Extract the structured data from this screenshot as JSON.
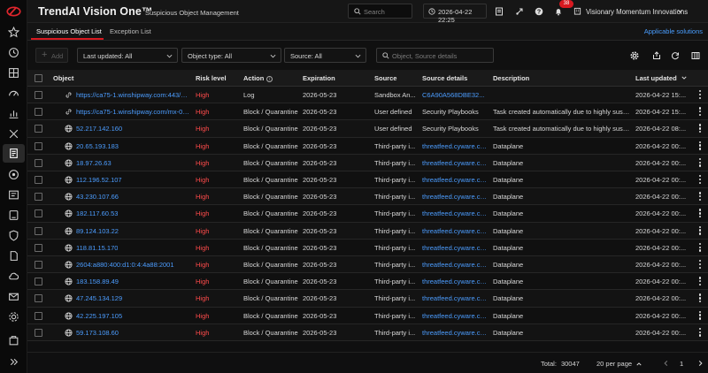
{
  "app": {
    "title": "TrendAI Vision One™",
    "page_name": "Suspicious Object Management",
    "search_placeholder": "Search",
    "datetime": "2026-04-22 22:25",
    "notification_count": "38",
    "organization": "Visionary Momentum Innovations"
  },
  "tabs": [
    {
      "label": "Suspicious Object List",
      "active": true
    },
    {
      "label": "Exception List",
      "active": false
    }
  ],
  "applicable_solutions": "Applicable solutions",
  "toolbar": {
    "add_label": "Add",
    "last_updated": "Last updated: All",
    "object_type": "Object type: All",
    "source": "Source: All",
    "search_placeholder": "Object, Source details"
  },
  "columns": {
    "object": "Object",
    "risk_level": "Risk level",
    "action": "Action",
    "expiration": "Expiration",
    "source": "Source",
    "source_details": "Source details",
    "description": "Description",
    "last_updated": "Last updated"
  },
  "rows": [
    {
      "type": "url",
      "object": "https://ca75-1.winshipway.com:443/mx-01-...",
      "risk": "High",
      "action": "Log",
      "expiration": "2026-05-23",
      "source": "Sandbox An...",
      "source_details": "C6A90A568DBE32...",
      "details_link": true,
      "description": "",
      "last_updated": "2026-04-22 15:..."
    },
    {
      "type": "url",
      "object": "https://ca75-1.winshipway.com/mx-01-007",
      "risk": "High",
      "action": "Block / Quarantine",
      "expiration": "2026-05-23",
      "source": "User defined",
      "source_details": "Security Playbooks",
      "details_link": false,
      "description": "Task created automatically due to highly suspicio...",
      "last_updated": "2026-04-22 15:..."
    },
    {
      "type": "ip",
      "object": "52.217.142.160",
      "risk": "High",
      "action": "Block / Quarantine",
      "expiration": "2026-05-23",
      "source": "User defined",
      "source_details": "Security Playbooks",
      "details_link": false,
      "description": "Task created automatically due to highly suspicio...",
      "last_updated": "2026-04-22 08:..."
    },
    {
      "type": "ip",
      "object": "20.65.193.183",
      "risk": "High",
      "action": "Block / Quarantine",
      "expiration": "2026-05-23",
      "source": "Third-party i...",
      "source_details": "threatfeed.cyware.co...",
      "details_link": true,
      "description": "Dataplane",
      "last_updated": "2026-04-22 00:..."
    },
    {
      "type": "ip",
      "object": "18.97.26.63",
      "risk": "High",
      "action": "Block / Quarantine",
      "expiration": "2026-05-23",
      "source": "Third-party i...",
      "source_details": "threatfeed.cyware.co...",
      "details_link": true,
      "description": "Dataplane",
      "last_updated": "2026-04-22 00:..."
    },
    {
      "type": "ip",
      "object": "112.196.52.107",
      "risk": "High",
      "action": "Block / Quarantine",
      "expiration": "2026-05-23",
      "source": "Third-party i...",
      "source_details": "threatfeed.cyware.co...",
      "details_link": true,
      "description": "Dataplane",
      "last_updated": "2026-04-22 00:..."
    },
    {
      "type": "ip",
      "object": "43.230.107.66",
      "risk": "High",
      "action": "Block / Quarantine",
      "expiration": "2026-05-23",
      "source": "Third-party i...",
      "source_details": "threatfeed.cyware.co...",
      "details_link": true,
      "description": "Dataplane",
      "last_updated": "2026-04-22 00:..."
    },
    {
      "type": "ip",
      "object": "182.117.60.53",
      "risk": "High",
      "action": "Block / Quarantine",
      "expiration": "2026-05-23",
      "source": "Third-party i...",
      "source_details": "threatfeed.cyware.co...",
      "details_link": true,
      "description": "Dataplane",
      "last_updated": "2026-04-22 00:..."
    },
    {
      "type": "ip",
      "object": "89.124.103.22",
      "risk": "High",
      "action": "Block / Quarantine",
      "expiration": "2026-05-23",
      "source": "Third-party i...",
      "source_details": "threatfeed.cyware.co...",
      "details_link": true,
      "description": "Dataplane",
      "last_updated": "2026-04-22 00:..."
    },
    {
      "type": "ip",
      "object": "118.81.15.170",
      "risk": "High",
      "action": "Block / Quarantine",
      "expiration": "2026-05-23",
      "source": "Third-party i...",
      "source_details": "threatfeed.cyware.co...",
      "details_link": true,
      "description": "Dataplane",
      "last_updated": "2026-04-22 00:..."
    },
    {
      "type": "ip",
      "object": "2604:a880:400:d1:0:4:4a88:2001",
      "risk": "High",
      "action": "Block / Quarantine",
      "expiration": "2026-05-23",
      "source": "Third-party i...",
      "source_details": "threatfeed.cyware.co...",
      "details_link": true,
      "description": "Dataplane",
      "last_updated": "2026-04-22 00:..."
    },
    {
      "type": "ip",
      "object": "183.158.89.49",
      "risk": "High",
      "action": "Block / Quarantine",
      "expiration": "2026-05-23",
      "source": "Third-party i...",
      "source_details": "threatfeed.cyware.co...",
      "details_link": true,
      "description": "Dataplane",
      "last_updated": "2026-04-22 00:..."
    },
    {
      "type": "ip",
      "object": "47.245.134.129",
      "risk": "High",
      "action": "Block / Quarantine",
      "expiration": "2026-05-23",
      "source": "Third-party i...",
      "source_details": "threatfeed.cyware.co...",
      "details_link": true,
      "description": "Dataplane",
      "last_updated": "2026-04-22 00:..."
    },
    {
      "type": "ip",
      "object": "42.225.197.105",
      "risk": "High",
      "action": "Block / Quarantine",
      "expiration": "2026-05-23",
      "source": "Third-party i...",
      "source_details": "threatfeed.cyware.co...",
      "details_link": true,
      "description": "Dataplane",
      "last_updated": "2026-04-22 00:..."
    },
    {
      "type": "ip",
      "object": "59.173.108.60",
      "risk": "High",
      "action": "Block / Quarantine",
      "expiration": "2026-05-23",
      "source": "Third-party i...",
      "source_details": "threatfeed.cyware.co...",
      "details_link": true,
      "description": "Dataplane",
      "last_updated": "2026-04-22 00:..."
    }
  ],
  "footer": {
    "total_label": "Total:",
    "total_value": "30047",
    "per_page": "20 per page",
    "page": "1"
  },
  "colors": {
    "accent": "#d71920",
    "link": "#4c9dff",
    "risk_high": "#ff4b4b"
  }
}
